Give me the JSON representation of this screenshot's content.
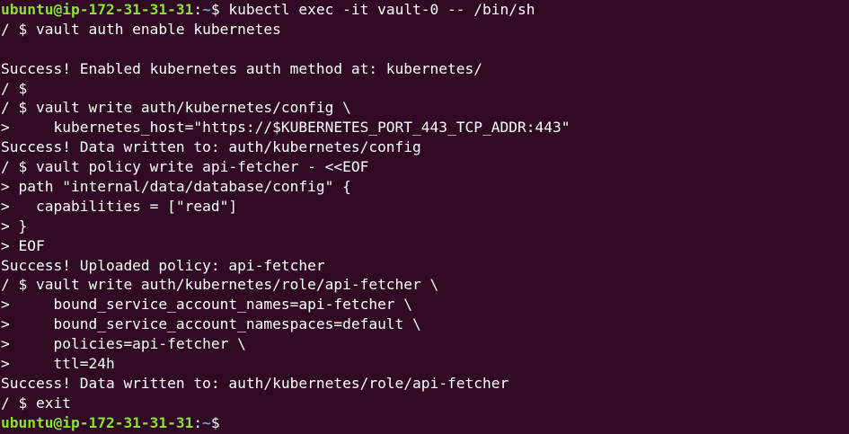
{
  "theme": {
    "background": "#300a24",
    "foreground": "#ffffff",
    "prompt_user_color": "#8ae234",
    "prompt_path_color": "#729fcf"
  },
  "lines": [
    {
      "type": "host-prompt",
      "user_host": "ubuntu@ip-172-31-31-31",
      "sep": ":",
      "path": "~",
      "dollar": "$ ",
      "text": "kubectl exec -it vault-0 -- /bin/sh"
    },
    {
      "type": "text",
      "text": "/ $ vault auth enable kubernetes"
    },
    {
      "type": "text",
      "text": ""
    },
    {
      "type": "text",
      "text": "Success! Enabled kubernetes auth method at: kubernetes/"
    },
    {
      "type": "text",
      "text": "/ $"
    },
    {
      "type": "text",
      "text": "/ $ vault write auth/kubernetes/config \\"
    },
    {
      "type": "text",
      "text": ">     kubernetes_host=\"https://$KUBERNETES_PORT_443_TCP_ADDR:443\""
    },
    {
      "type": "text",
      "text": "Success! Data written to: auth/kubernetes/config"
    },
    {
      "type": "text",
      "text": "/ $ vault policy write api-fetcher - <<EOF"
    },
    {
      "type": "text",
      "text": "> path \"internal/data/database/config\" {"
    },
    {
      "type": "text",
      "text": ">   capabilities = [\"read\"]"
    },
    {
      "type": "text",
      "text": "> }"
    },
    {
      "type": "text",
      "text": "> EOF"
    },
    {
      "type": "text",
      "text": "Success! Uploaded policy: api-fetcher"
    },
    {
      "type": "text",
      "text": "/ $ vault write auth/kubernetes/role/api-fetcher \\"
    },
    {
      "type": "text",
      "text": ">     bound_service_account_names=api-fetcher \\"
    },
    {
      "type": "text",
      "text": ">     bound_service_account_namespaces=default \\"
    },
    {
      "type": "text",
      "text": ">     policies=api-fetcher \\"
    },
    {
      "type": "text",
      "text": ">     ttl=24h"
    },
    {
      "type": "text",
      "text": "Success! Data written to: auth/kubernetes/role/api-fetcher"
    },
    {
      "type": "text",
      "text": "/ $ exit"
    },
    {
      "type": "host-prompt",
      "user_host": "ubuntu@ip-172-31-31-31",
      "sep": ":",
      "path": "~",
      "dollar": "$ ",
      "text": ""
    }
  ]
}
